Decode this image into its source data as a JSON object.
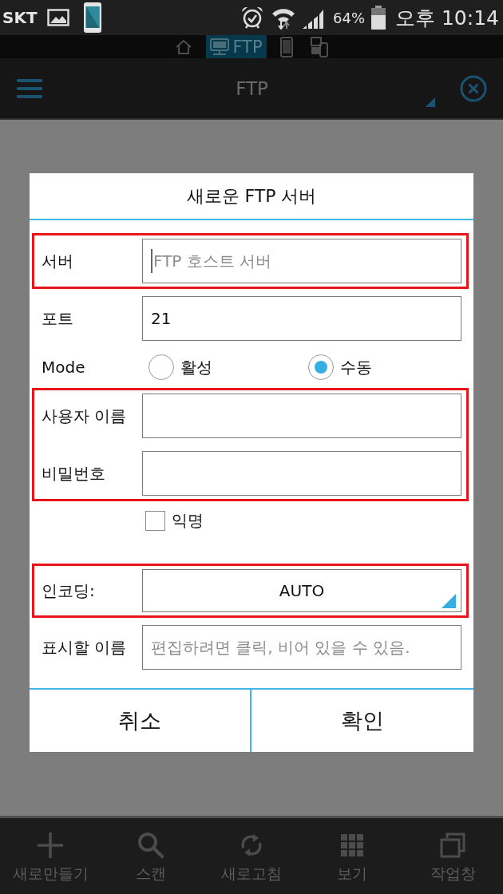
{
  "status_bar": {
    "carrier": "SKT",
    "battery": "64%",
    "time": "오후 10:14"
  },
  "tab_strip": {
    "tabs": [
      {
        "selected": false
      },
      {
        "label": "FTP",
        "selected": true
      },
      {
        "selected": false
      },
      {
        "selected": false
      }
    ]
  },
  "toolbar": {
    "title": "FTP"
  },
  "dialog": {
    "title": "새로운 FTP 서버",
    "groups": [
      {
        "highlighted": true,
        "rows": [
          {
            "kind": "text",
            "label": "서버",
            "placeholder": "FTP 호스트 서버",
            "focused": true
          }
        ]
      },
      {
        "highlighted": false,
        "rows": [
          {
            "kind": "text",
            "label": "포트",
            "value": "21",
            "focused": false
          },
          {
            "kind": "radio",
            "label": "Mode",
            "options": [
              {
                "label": "활성",
                "selected": false
              },
              {
                "label": "수동",
                "selected": true
              }
            ]
          }
        ]
      },
      {
        "highlighted": true,
        "rows": [
          {
            "kind": "text",
            "label": "사용자 이름",
            "focused": false
          },
          {
            "kind": "text",
            "label": "비밀번호",
            "focused": false
          }
        ]
      },
      {
        "highlighted": false,
        "rows": [
          {
            "kind": "checkbox",
            "label": "익명",
            "checked": false
          }
        ]
      },
      {
        "highlighted": true,
        "rows": [
          {
            "kind": "dropdown",
            "label": "인코딩:",
            "value": "AUTO"
          }
        ]
      },
      {
        "highlighted": false,
        "rows": [
          {
            "kind": "text",
            "label": "표시할 이름",
            "placeholder": "편집하려면 클릭, 비어 있을 수 있음.",
            "focused": false
          }
        ]
      }
    ],
    "buttons": [
      {
        "label": "취소"
      },
      {
        "label": "확인"
      }
    ]
  },
  "bottom_nav": {
    "items": [
      {
        "label": "새로만들기"
      },
      {
        "label": "스캔"
      },
      {
        "label": "새로고침"
      },
      {
        "label": "보기"
      },
      {
        "label": "작업창"
      }
    ]
  }
}
